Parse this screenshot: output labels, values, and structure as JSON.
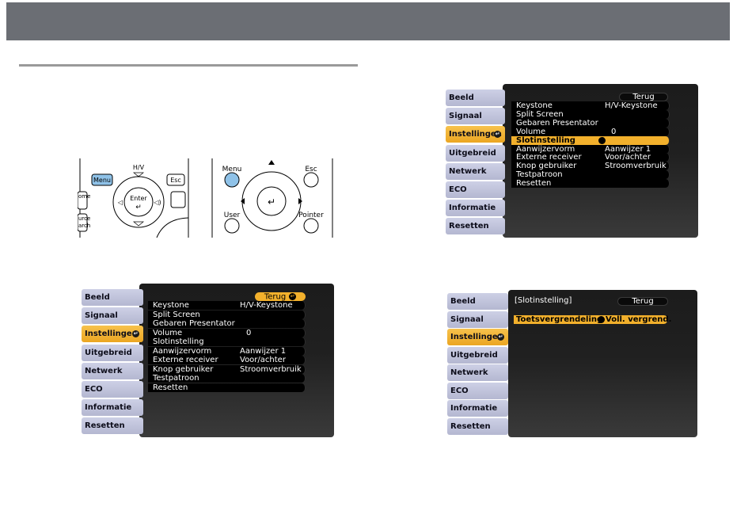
{
  "remote": {
    "menu_label": "Menu",
    "hv_label": "H/V",
    "esc_label": "Esc",
    "enter_label": "Enter",
    "home_label": "ome",
    "source_label_1": "urce",
    "source_label_2": "arch",
    "menu_label_2": "Menu",
    "esc_label_2": "Esc",
    "user_label": "User",
    "pointer_label": "Pointer"
  },
  "tabs": [
    "Beeld",
    "Signaal",
    "Instellingen",
    "Uitgebreid",
    "Netwerk",
    "ECO",
    "Informatie",
    "Resetten"
  ],
  "menu": {
    "back": "Terug",
    "items": [
      {
        "label": "Keystone",
        "value": "H/V-Keystone"
      },
      {
        "label": "Split Screen",
        "value": ""
      },
      {
        "label": "Gebaren Presentator",
        "value": ""
      },
      {
        "label": "Volume",
        "value": "0"
      },
      {
        "label": "Slotinstelling",
        "value": ""
      },
      {
        "label": "Aanwijzervorm",
        "value": "Aanwijzer 1"
      },
      {
        "label": "Externe receiver",
        "value": "Voor/achter"
      },
      {
        "label": "Knop gebruiker",
        "value": "Stroomverbruik"
      },
      {
        "label": "Testpatroon",
        "value": ""
      },
      {
        "label": "Resetten",
        "value": ""
      }
    ]
  },
  "submenu": {
    "title": "[Slotinstelling]",
    "back": "Terug",
    "item_label": "Toetsvergrendeling",
    "item_value": "Voll. vergrend."
  },
  "colors": {
    "topbar": "#6b6e74",
    "highlight": "#f2b02c",
    "tab": "#c3c6de",
    "osd_bg": "#1c1c1c"
  }
}
